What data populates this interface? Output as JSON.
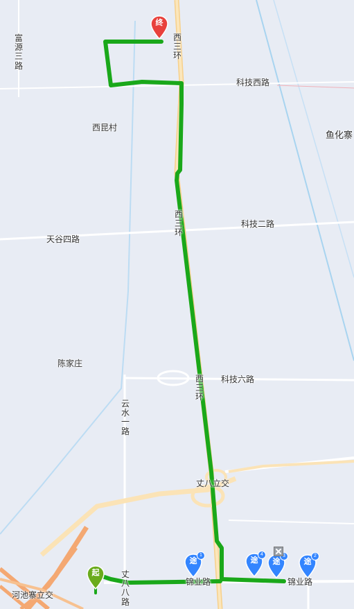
{
  "map": {
    "road_labels": {
      "xi_san_huan": "西三环",
      "keji_xi_lu": "科技西路",
      "keji_er_lu": "科技二路",
      "keji_liu_lu": "科技六路",
      "tiangu_si_lu": "天谷四路",
      "fuyuan_san_lu": "富源三路",
      "yunshui_yi_lu": "云水一路",
      "zhangba_ba_lu": "丈八八路",
      "jinye_lu": "锦业路"
    },
    "place_labels": {
      "xikun_cun": "西昆村",
      "yuhuazhai": "鱼化寨",
      "chenjiazhuang": "陈家庄",
      "zhangba_interchange": "丈八立交",
      "hechizhai_interchange": "河池寨立交"
    },
    "markers": {
      "start": {
        "label": "起",
        "color": "#6aab1c"
      },
      "end": {
        "label": "终",
        "color": "#e8413c"
      },
      "waypoints": [
        {
          "label": "途",
          "number": "1"
        },
        {
          "label": "途",
          "number": "4"
        },
        {
          "label": "途",
          "number": "3"
        },
        {
          "label": "途",
          "number": "2"
        }
      ],
      "waypoint_color": "#3385ff"
    },
    "route_color": "#1aa81a"
  }
}
